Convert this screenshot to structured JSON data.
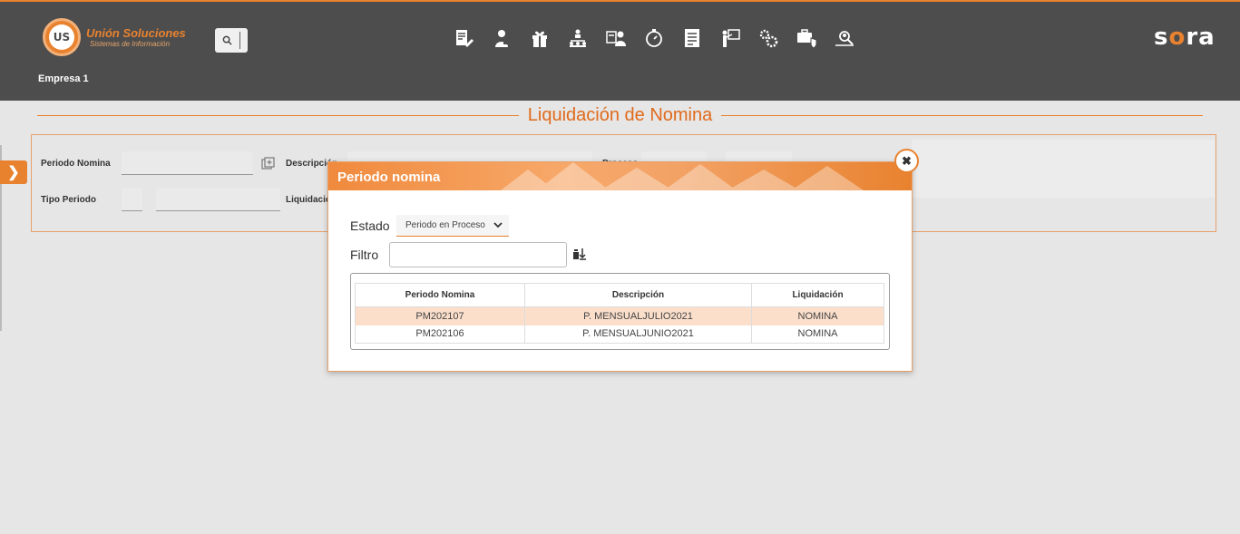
{
  "header": {
    "company_title": "Unión Soluciones",
    "company_subtitle": "Sistemas de Información",
    "logo_letters": "US",
    "empresa": "Empresa 1",
    "brand_prefix": "s",
    "brand_o": "o",
    "brand_suffix": "ra",
    "toolbar_icons": [
      "document-edit-icon",
      "employee-icon",
      "gift-icon",
      "org-chart-icon",
      "user-card-icon",
      "timer-icon",
      "report-icon",
      "training-icon",
      "settings-icon",
      "security-icon",
      "search-users-icon"
    ]
  },
  "page": {
    "title": "Liquidación de Nomina"
  },
  "form": {
    "periodo_label": "Periodo Nomina",
    "descripcion_label": "Descripción",
    "tipo_periodo_label": "Tipo Periodo",
    "liquidacion_label": "Liquidación",
    "proceso_label": "Proceso"
  },
  "modal": {
    "title": "Periodo nomina",
    "estado_label": "Estado",
    "estado_value": "Periodo en Proceso",
    "filtro_label": "Filtro",
    "filtro_value": "",
    "columns": [
      "Periodo Nomina",
      "Descripción",
      "Liquidación"
    ],
    "rows": [
      {
        "periodo": "PM202107",
        "descripcion": "P. MENSUALJULIO2021",
        "liquidacion": "NOMINA"
      },
      {
        "periodo": "PM202106",
        "descripcion": "P. MENSUALJUNIO2021",
        "liquidacion": "NOMINA"
      }
    ]
  },
  "colors": {
    "accent": "#e8822f",
    "header_bg": "#4d4d4d",
    "selected_row": "#fbdfcb"
  }
}
